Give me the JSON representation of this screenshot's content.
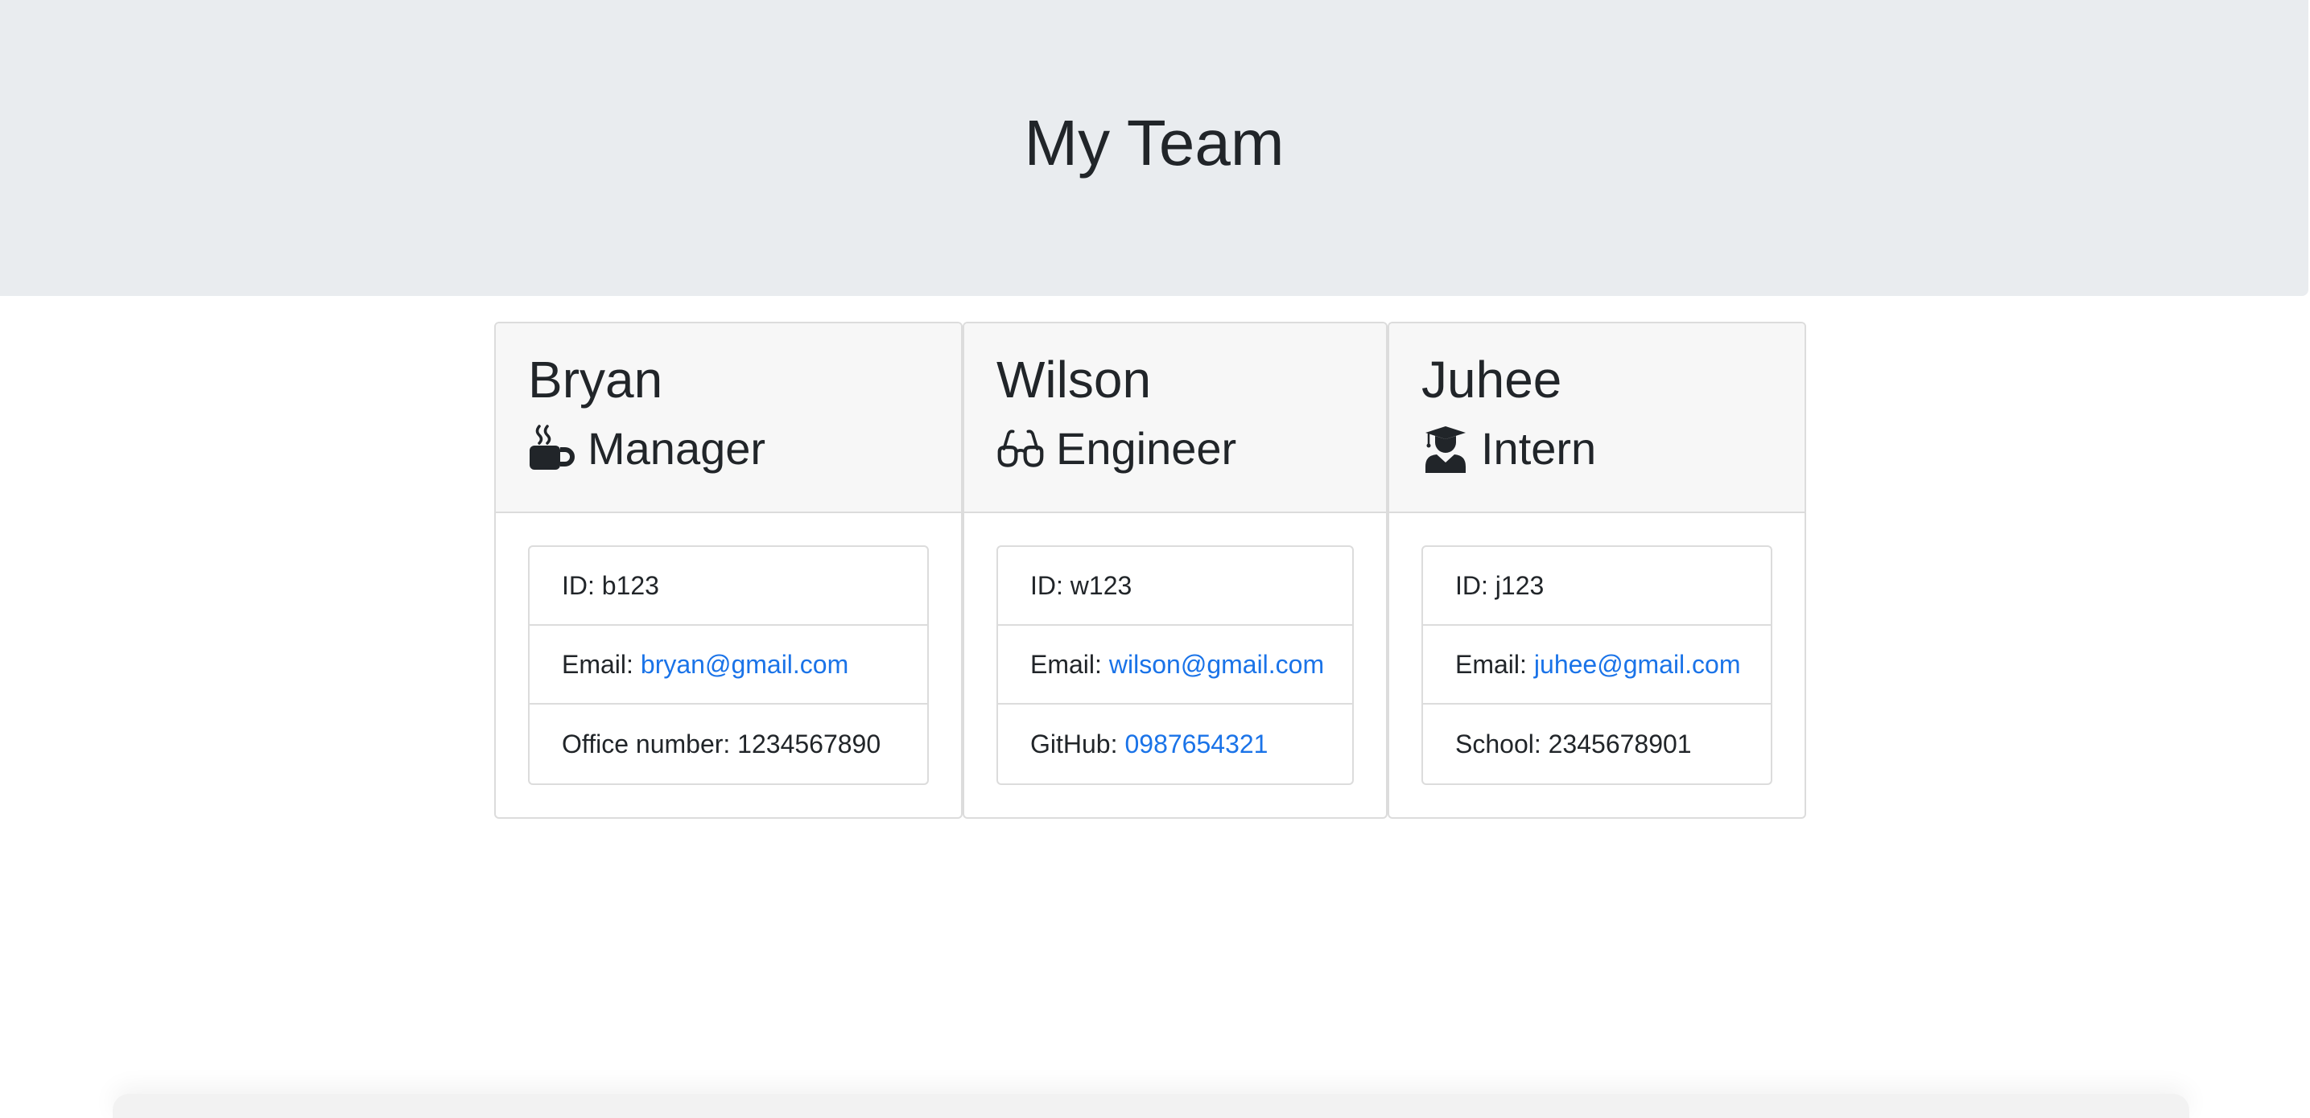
{
  "header": {
    "title": "My Team"
  },
  "employees": [
    {
      "name": "Bryan",
      "role": "Manager",
      "role_icon": "mug-hot-icon",
      "id_label": "ID: ",
      "id_value": "b123",
      "email_label": "Email:",
      "email": "bryan@gmail.com",
      "extra_label": "Office number: ",
      "extra_value": "1234567890"
    },
    {
      "name": "Wilson",
      "role": "Engineer",
      "role_icon": "glasses-icon",
      "id_label": "ID: ",
      "id_value": "w123",
      "email_label": "Email:",
      "email": "wilson@gmail.com",
      "extra_label": "GitHub:",
      "extra_value": "0987654321"
    },
    {
      "name": "Juhee",
      "role": "Intern",
      "role_icon": "user-graduate-icon",
      "id_label": "ID: ",
      "id_value": "j123",
      "email_label": "Email:",
      "email": "juhee@gmail.com",
      "extra_label": "School: ",
      "extra_value": "2345678901"
    }
  ],
  "colors": {
    "hero_bg": "#e9ecef",
    "link": "#1a73e8",
    "text": "#212529"
  }
}
